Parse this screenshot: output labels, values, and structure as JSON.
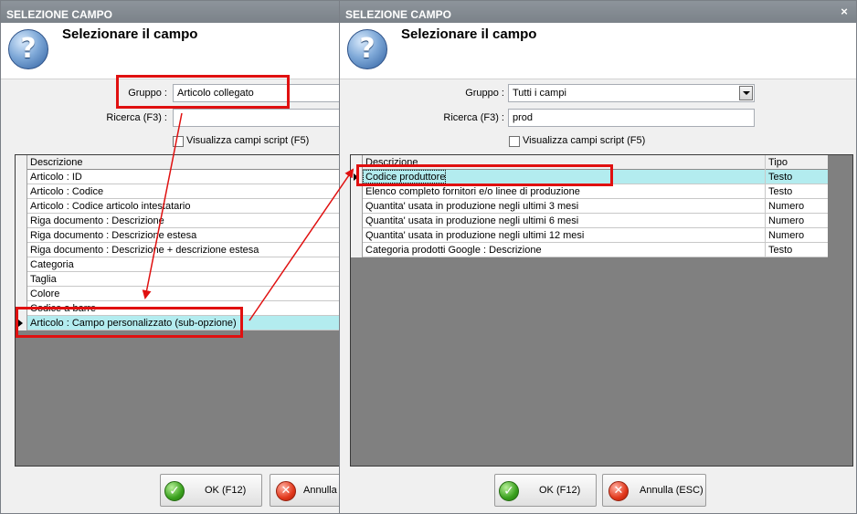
{
  "colors": {
    "highlight": "#e01010",
    "selected_row": "#b3ecef",
    "grid_bg": "#808080",
    "title_bar": "#868d94"
  },
  "left": {
    "window_title": "SELEZIONE CAMPO",
    "header_title": "Selezionare il campo",
    "gruppo_label": "Gruppo :",
    "gruppo_value": "Articolo collegato",
    "ricerca_label": "Ricerca (F3) :",
    "ricerca_value": "",
    "script_label": "Visualizza campi script (F5)",
    "column_descrizione": "Descrizione",
    "rows": [
      "Articolo : ID",
      "Articolo : Codice",
      "Articolo : Codice articolo intestatario",
      "Riga documento : Descrizione",
      "Riga documento : Descrizione estesa",
      "Riga documento : Descrizione + descrizione estesa",
      "Categoria",
      "Taglia",
      "Colore",
      "Codice a barre",
      "Articolo : Campo personalizzato (sub-opzione)"
    ],
    "selected_row": "Articolo : Campo personalizzato (sub-opzione)",
    "ok_label": "OK (F12)",
    "cancel_label": "Annulla ("
  },
  "right": {
    "window_title": "SELEZIONE CAMPO",
    "close_glyph": "×",
    "header_title": "Selezionare il campo",
    "gruppo_label": "Gruppo :",
    "gruppo_value": "Tutti i campi",
    "ricerca_label": "Ricerca (F3) :",
    "ricerca_value": "prod",
    "script_label": "Visualizza campi script (F5)",
    "column_descrizione": "Descrizione",
    "column_tipo": "Tipo",
    "rows": [
      {
        "descrizione": "Codice produttore",
        "tipo": "Testo"
      },
      {
        "descrizione": "Elenco completo fornitori e/o linee di produzione",
        "tipo": "Testo"
      },
      {
        "descrizione": "Quantita' usata in produzione negli ultimi 3 mesi",
        "tipo": "Numero"
      },
      {
        "descrizione": "Quantita' usata in produzione negli ultimi 6 mesi",
        "tipo": "Numero"
      },
      {
        "descrizione": "Quantita' usata in produzione negli ultimi 12 mesi",
        "tipo": "Numero"
      },
      {
        "descrizione": "Categoria prodotti Google : Descrizione",
        "tipo": "Testo"
      }
    ],
    "selected_row": "Codice produttore",
    "ok_label": "OK (F12)",
    "cancel_label": "Annulla (ESC)"
  }
}
